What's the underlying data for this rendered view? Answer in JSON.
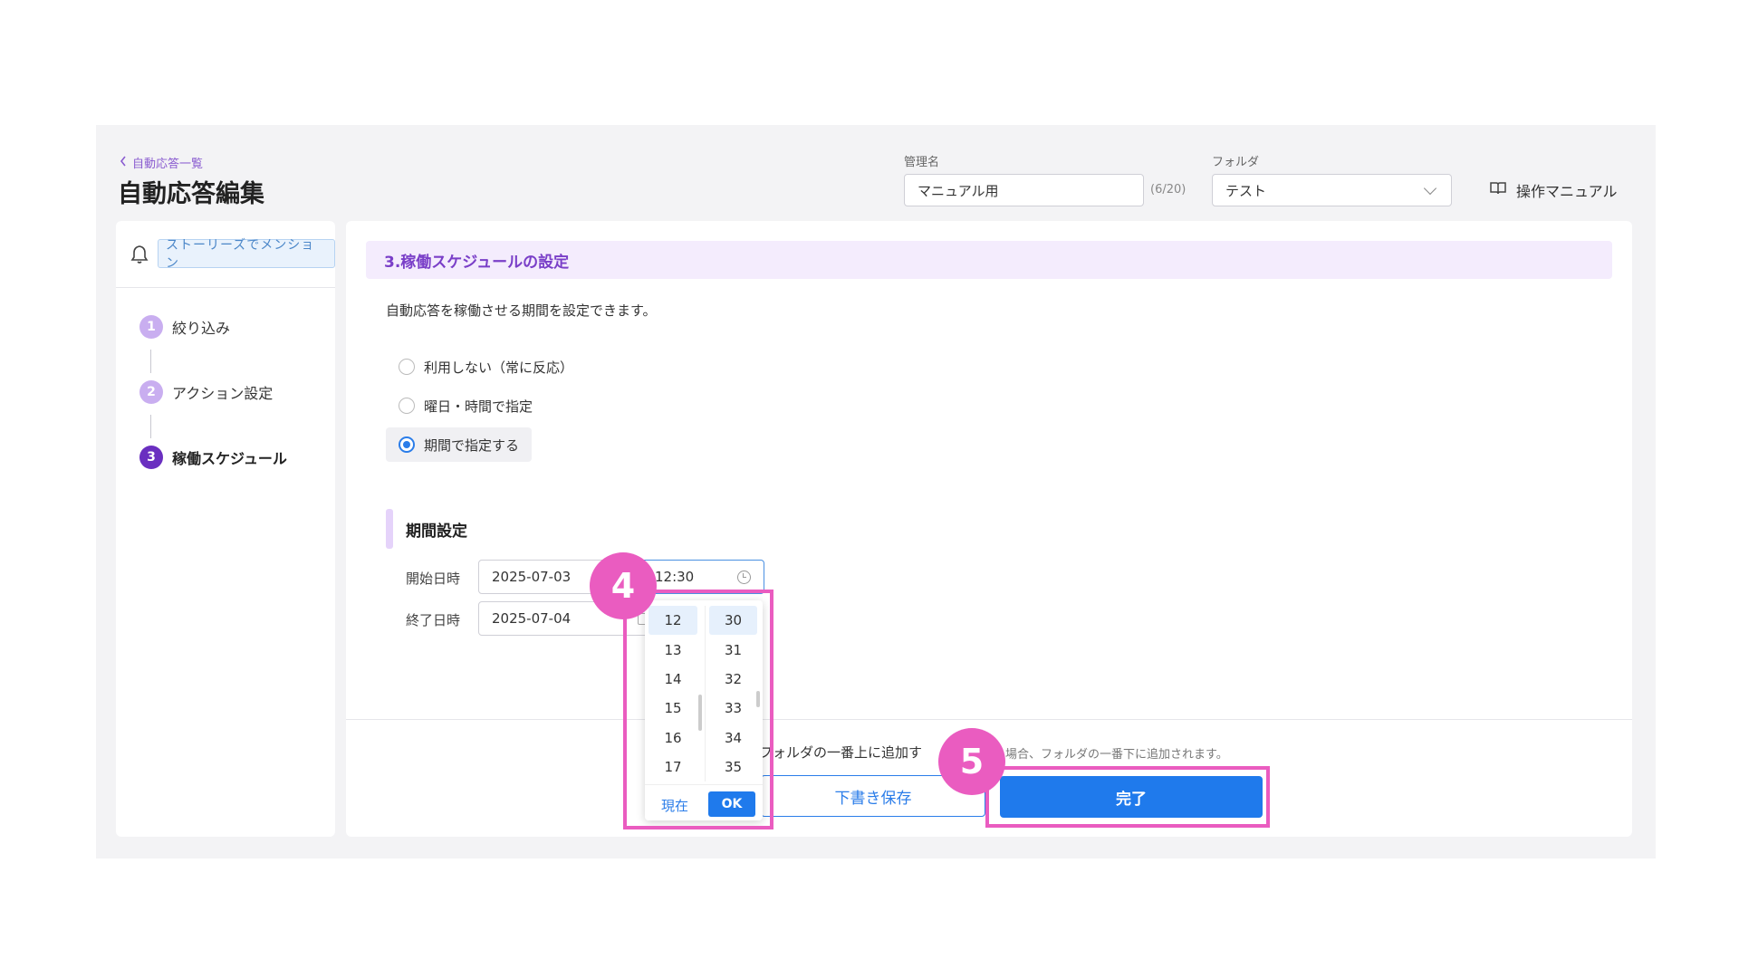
{
  "header": {
    "back_label": "自動応答一覧",
    "title": "自動応答編集",
    "name_label": "管理名",
    "name_value": "マニュアル用",
    "name_counter": "(6/20)",
    "folder_label": "フォルダ",
    "folder_value": "テスト",
    "manual_label": "操作マニュアル"
  },
  "sidebar": {
    "trigger_tag": "ストーリーズでメンション",
    "steps": [
      {
        "num": "1",
        "label": "絞り込み"
      },
      {
        "num": "2",
        "label": "アクション設定"
      },
      {
        "num": "3",
        "label": "稼働スケジュール"
      }
    ]
  },
  "main": {
    "section_title": "3.稼働スケジュールの設定",
    "description": "自動応答を稼働させる期間を設定できます。",
    "options": [
      {
        "label": "利用しない（常に反応）"
      },
      {
        "label": "曜日・時間で指定"
      },
      {
        "label": "期間で指定する"
      }
    ],
    "period_title": "期間設定",
    "start_label": "開始日時",
    "start_date": "2025-07-03",
    "start_time": "12:30",
    "end_label": "終了日時",
    "end_date": "2025-07-04"
  },
  "picker": {
    "hours": [
      "12",
      "13",
      "14",
      "15",
      "16",
      "17"
    ],
    "minutes": [
      "30",
      "31",
      "32",
      "33",
      "34",
      "35"
    ],
    "now_label": "現在",
    "ok_label": "OK"
  },
  "footer": {
    "note_left": "フォルダの一番上に追加す",
    "note_right": "場合、フォルダの一番下に追加されます。",
    "draft_label": "下書き保存",
    "done_label": "完了"
  },
  "annotations": {
    "badge_4": "4",
    "badge_5": "5",
    "color": "#ea5cc0"
  }
}
